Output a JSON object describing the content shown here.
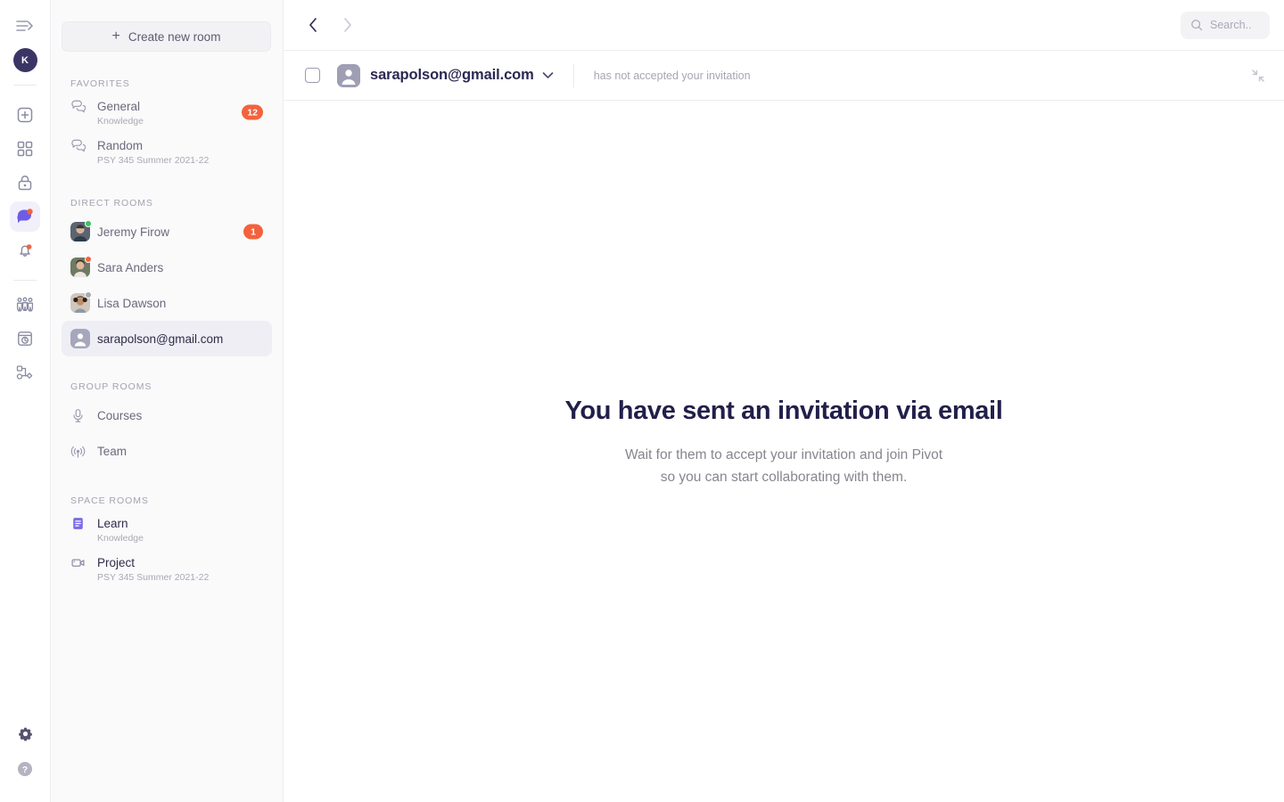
{
  "rail": {
    "avatar_initial": "K",
    "hamburger": "menu-expand-icon",
    "items": [
      {
        "name": "add",
        "icon": "plus-square-icon",
        "active": false
      },
      {
        "name": "apps",
        "icon": "grid-icon",
        "active": false
      },
      {
        "name": "vault",
        "icon": "lock-icon",
        "active": false
      },
      {
        "name": "chat",
        "icon": "chat-bubble-icon",
        "active": true,
        "dot": true
      },
      {
        "name": "notifications",
        "icon": "bell-icon",
        "active": false,
        "dot": true
      },
      {
        "name": "people",
        "icon": "people-group-icon",
        "active": false
      },
      {
        "name": "history",
        "icon": "clock-window-icon",
        "active": false
      },
      {
        "name": "workflow",
        "icon": "workflow-nodes-icon",
        "active": false
      }
    ],
    "bottom": [
      {
        "name": "settings",
        "icon": "gear-icon"
      },
      {
        "name": "help",
        "icon": "help-circle-icon"
      }
    ]
  },
  "topbar": {
    "back_icon": "chevron-left-icon",
    "forward_icon": "chevron-right-icon",
    "search": {
      "icon": "search-icon",
      "placeholder": "Search.."
    }
  },
  "sidebar": {
    "create_button": {
      "label": "Create new room",
      "icon": "plus-icon"
    },
    "sections": [
      {
        "label": "FAVORITES",
        "rooms": [
          {
            "title": "General",
            "subtitle": "Knowledge",
            "icon": "chat-bubbles-icon",
            "badge": "12"
          },
          {
            "title": "Random",
            "subtitle": "PSY 345 Summer 2021-22",
            "icon": "chat-bubbles-icon",
            "badge": ""
          }
        ]
      },
      {
        "label": "DIRECT ROOMS",
        "rooms": [
          {
            "title": "Jeremy Firow",
            "subtitle": "",
            "icon": "user-avatar",
            "badge": "1",
            "status": "online"
          },
          {
            "title": "Sara Anders",
            "subtitle": "",
            "icon": "user-avatar",
            "badge": "",
            "status": "busy"
          },
          {
            "title": "Lisa Dawson",
            "subtitle": "",
            "icon": "user-avatar",
            "badge": "",
            "status": "away"
          },
          {
            "title": "sarapolson@gmail.com",
            "subtitle": "",
            "icon": "user-placeholder-avatar",
            "badge": "",
            "selected": true
          }
        ]
      },
      {
        "label": "GROUP ROOMS",
        "rooms": [
          {
            "title": "Courses",
            "subtitle": "",
            "icon": "microphone-icon",
            "badge": ""
          },
          {
            "title": "Team",
            "subtitle": "",
            "icon": "broadcast-icon",
            "badge": ""
          }
        ]
      },
      {
        "label": "SPACE ROOMS",
        "rooms": [
          {
            "title": "Learn",
            "subtitle": "Knowledge",
            "icon": "document-list-icon",
            "badge": ""
          },
          {
            "title": "Project",
            "subtitle": "PSY 345 Summer 2021-22",
            "icon": "video-camera-icon",
            "badge": ""
          }
        ]
      }
    ]
  },
  "conversation": {
    "checkbox_icon": "rounded-square-icon",
    "avatar_icon": "user-placeholder-avatar",
    "name": "sarapolson@gmail.com",
    "caret_icon": "chevron-down-icon",
    "status_text": "has not accepted your invitation",
    "collapse_icon": "collapse-arrows-icon"
  },
  "empty_state": {
    "title": "You have sent an invitation via email",
    "line1": "Wait for them to accept your invitation and join Pivot",
    "line2": "so you can start collaborating with them."
  },
  "colors": {
    "accent_purple": "#6c5ce7",
    "badge_orange": "#f2633d",
    "text_dark": "#221f4a",
    "text_muted": "#86868f"
  }
}
